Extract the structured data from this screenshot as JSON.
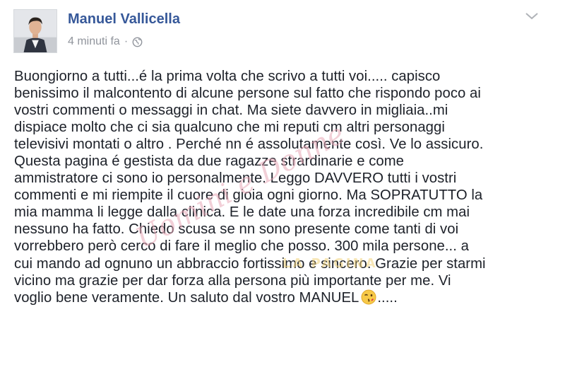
{
  "post": {
    "author": "Manuel Vallicella",
    "timestamp": "4 minuti fa",
    "separator": "·",
    "lines": [
      "Buongiorno a tutti...é la prima volta che scrivo a tutti voi..... capisco",
      "benissimo il malcontento di alcune persone sul fatto che rispondo poco ai",
      "vostri commenti o messaggi in chat. Ma siete davvero in migliaia..mi",
      "dispiace molto che ci sia qualcuno che mi reputi cm altri personaggi",
      "televisivi montati o altro . Perché nn é assolutamente così. Ve lo assicuro.",
      "Questa pagina é gestista da due ragazze strardinarie e come",
      "ammistratore ci sono io personalmente. Leggo DAVVERO tutti i vostri",
      "commenti e mi riempite il cuore di gioia ogni giorno. Ma SOPRATUTTO la",
      "mia mamma li legge dalla clinica. E le date una forza incredibile cm mai",
      "nessuno ha fatto. Chiedo scusa se nn sono presente come tanti di voi",
      "vorrebbero però cerco di fare il meglio che posso. 300 mila persone... a",
      "cui mando ad ognuno un abbraccio fortissimo e sincero. Grazie per starmi",
      "vicino ma grazie per dar forza alla persona più importante per me. Vi",
      "voglio bene veramente. Un saluto dal vostro MANUEL"
    ],
    "closing": ".....",
    "emoji": "kissing-wink-emoji-icon",
    "privacy_icon": "globe-icon",
    "menu_icon": "chevron-down-icon"
  },
  "watermark": {
    "main": "Uomini e Donne",
    "sub": "LA PAGINA"
  },
  "colors": {
    "author": "#365899",
    "meta": "#90949c",
    "text": "#1d2129"
  }
}
